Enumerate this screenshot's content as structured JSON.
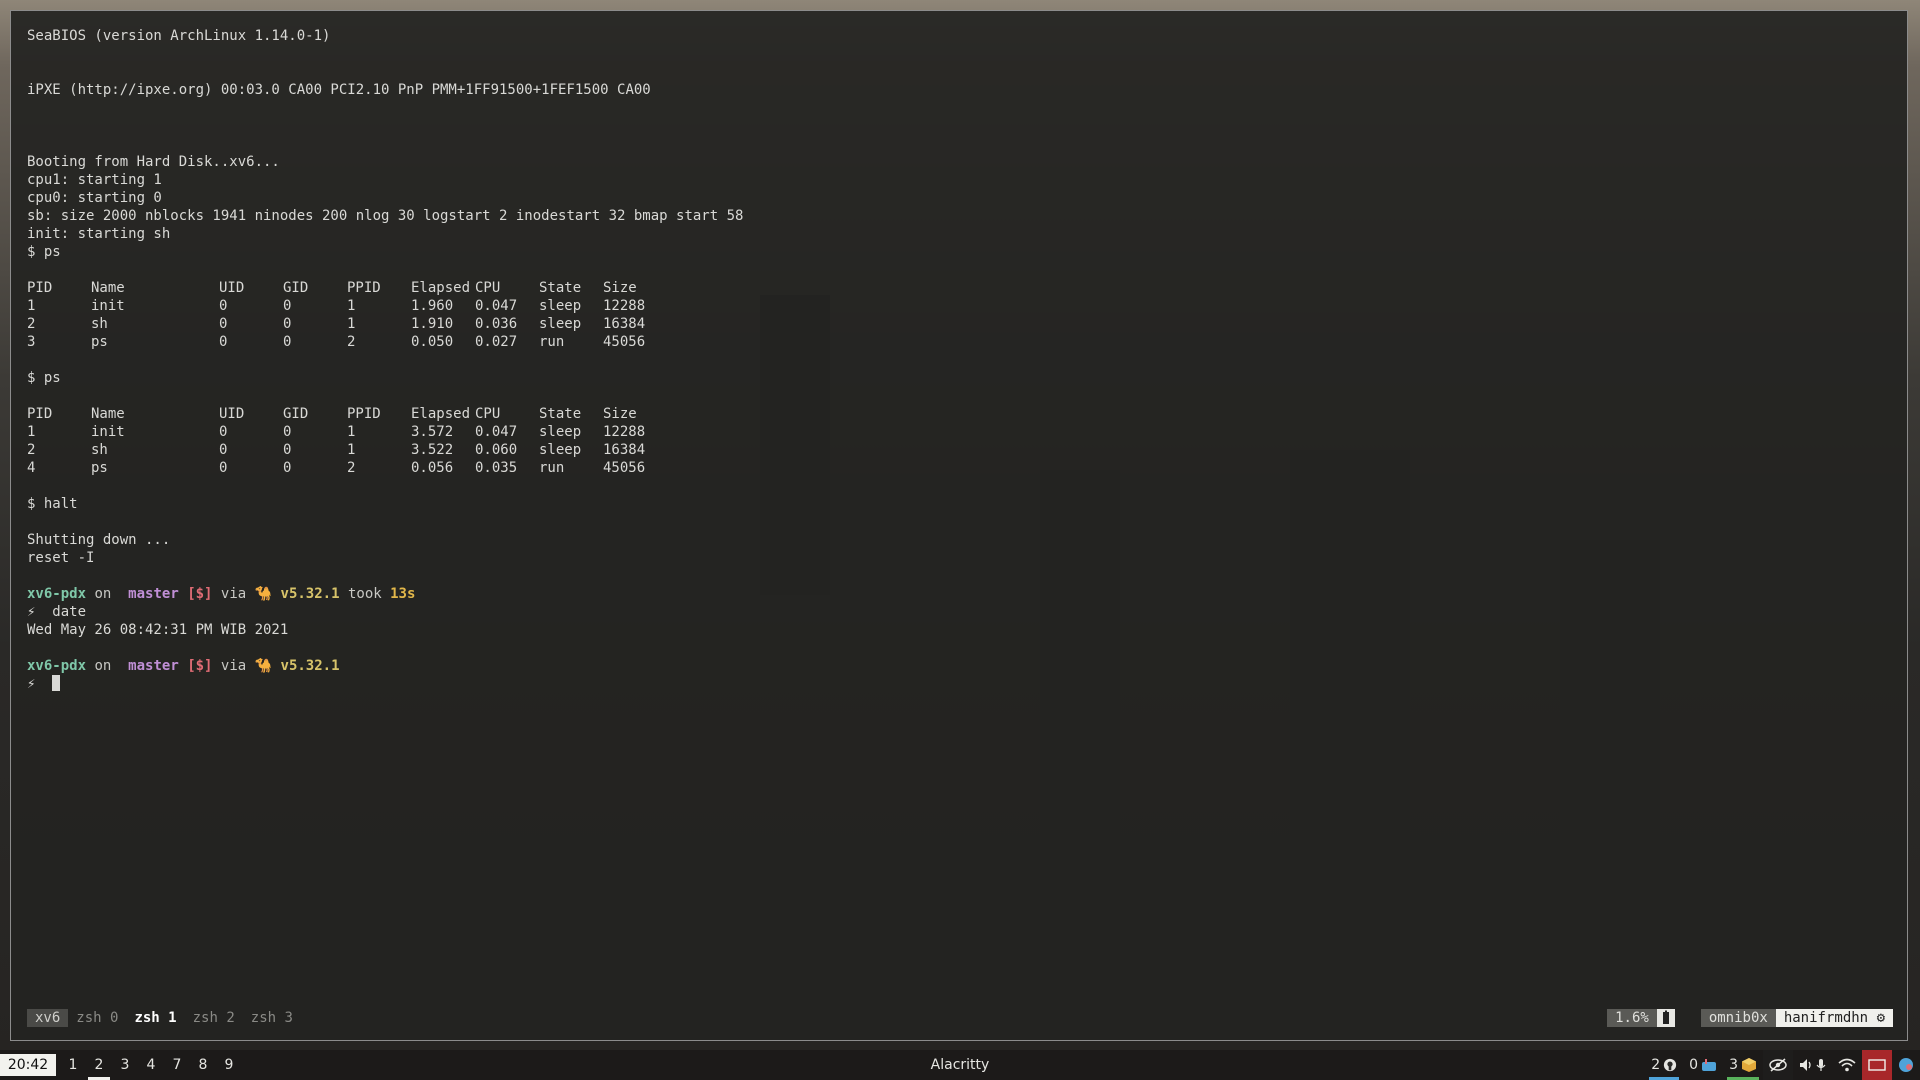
{
  "terminal": {
    "boot": [
      "SeaBIOS (version ArchLinux 1.14.0-1)",
      "",
      "",
      "iPXE (http://ipxe.org) 00:03.0 CA00 PCI2.10 PnP PMM+1FF91500+1FEF1500 CA00",
      "",
      "",
      "",
      "Booting from Hard Disk..xv6...",
      "cpu1: starting 1",
      "cpu0: starting 0",
      "sb: size 2000 nblocks 1941 ninodes 200 nlog 30 logstart 2 inodestart 32 bmap start 58",
      "init: starting sh",
      "$ ps"
    ],
    "ps_header": [
      "PID",
      "Name",
      "UID",
      "GID",
      "PPID",
      "Elapsed",
      "CPU",
      "State",
      "Size"
    ],
    "ps1": [
      [
        "1",
        "init",
        "0",
        "0",
        "1",
        "1.960",
        "0.047",
        "sleep",
        "12288"
      ],
      [
        "2",
        "sh",
        "0",
        "0",
        "1",
        "1.910",
        "0.036",
        "sleep",
        "16384"
      ],
      [
        "3",
        "ps",
        "0",
        "0",
        "2",
        "0.050",
        "0.027",
        "run",
        "45056"
      ]
    ],
    "cmd2": "$ ps",
    "ps2": [
      [
        "1",
        "init",
        "0",
        "0",
        "1",
        "3.572",
        "0.047",
        "sleep",
        "12288"
      ],
      [
        "2",
        "sh",
        "0",
        "0",
        "1",
        "3.522",
        "0.060",
        "sleep",
        "16384"
      ],
      [
        "4",
        "ps",
        "0",
        "0",
        "2",
        "0.056",
        "0.035",
        "run",
        "45056"
      ]
    ],
    "cmd3": "$ halt",
    "shutdown": "Shutting down ...",
    "reset": "reset -I",
    "prompt1": {
      "dir": "xv6-pdx",
      "on": " on ",
      "branch_icon": "",
      "branch": "master",
      "status": "[$]",
      "via": " via ",
      "lang_icon": "🐪",
      "version": "v5.32.1",
      "took_label": " took ",
      "took": "13s"
    },
    "cmd4_symbol": "⚡",
    "cmd4": "date",
    "date_output": "Wed May 26 08:42:31 PM WIB 2021",
    "prompt2": {
      "dir": "xv6-pdx",
      "on": " on ",
      "branch_icon": "",
      "branch": "master",
      "status": "[$]",
      "via": " via ",
      "lang_icon": "🐪",
      "version": "v5.32.1"
    },
    "cmd5_symbol": "⚡"
  },
  "tmux": {
    "session": "xv6",
    "windows": [
      "zsh 0",
      "zsh 1",
      "zsh 2",
      "zsh 3"
    ],
    "active_window": "zsh 1",
    "cpu": "1.6%",
    "host": "omnib0x",
    "user": "hanifrmdhn",
    "user_icon": "gear-icon"
  },
  "taskbar": {
    "clock": "20:42",
    "workspaces": [
      "1",
      "2",
      "3",
      "4",
      "7",
      "8",
      "9"
    ],
    "active_workspace": "2",
    "window_title": "Alacritty",
    "tray": {
      "github_count": "2",
      "mail_count": "0",
      "updates_count": "3"
    }
  },
  "colors": {
    "dir": "#7fc7a8",
    "branch": "#c08fd6",
    "status": "#e06c75",
    "version": "#d8c46a",
    "accent_blue": "#4fa3d9",
    "accent_red": "#a8272a"
  }
}
